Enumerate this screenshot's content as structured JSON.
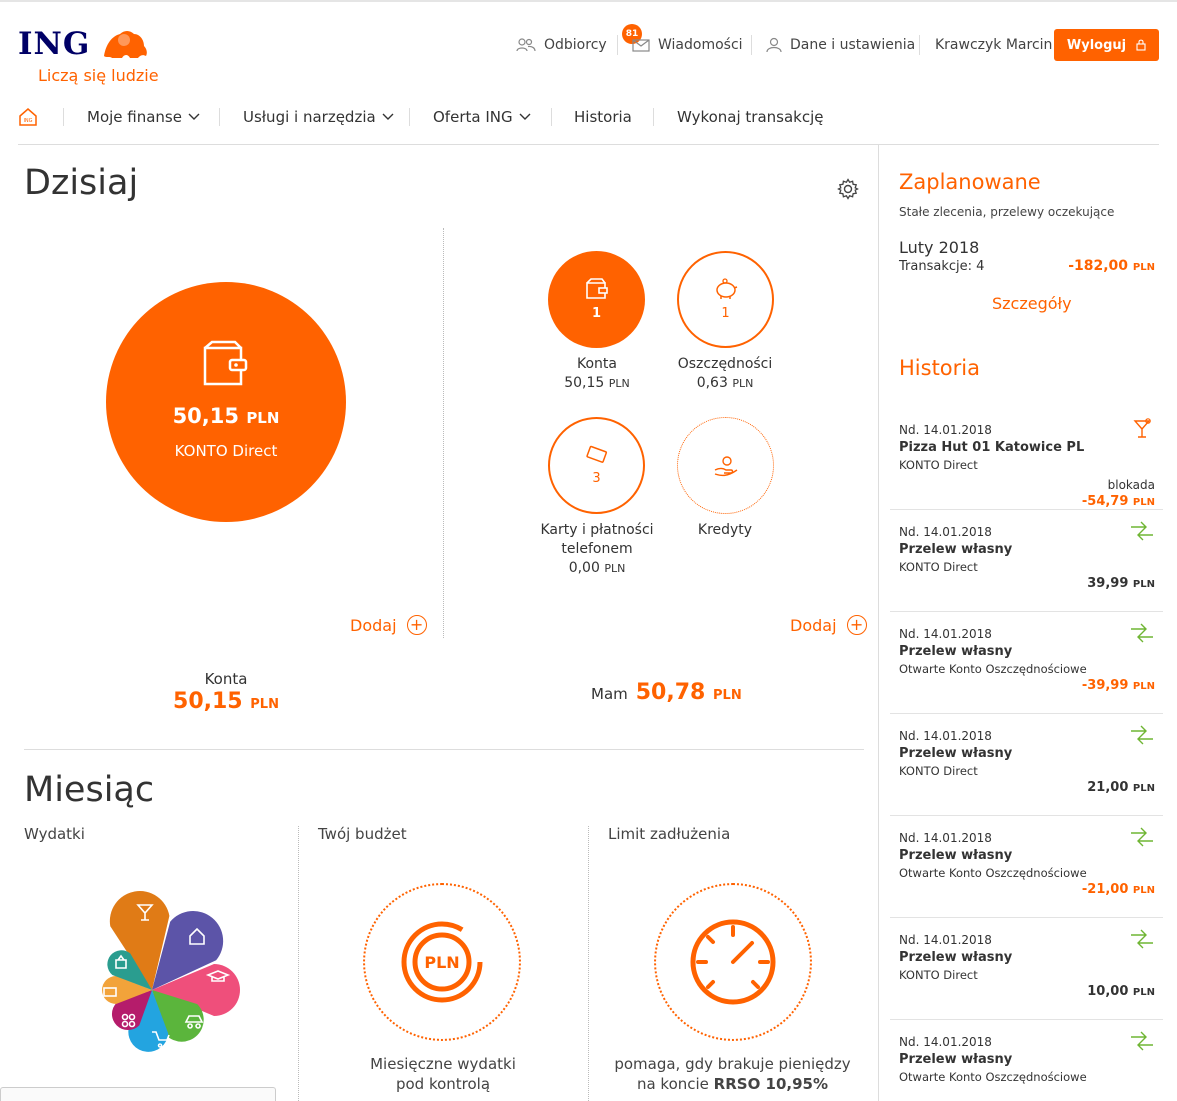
{
  "header": {
    "logo_text": "ING",
    "tagline": "Liczą się ludzie",
    "nav": {
      "recipients": "Odbiorcy",
      "messages": "Wiadomości",
      "messages_badge": "81",
      "settings": "Dane i ustawienia",
      "user_name": "Krawczyk Marcin",
      "logout": "Wyloguj"
    }
  },
  "main_nav": {
    "my_finances": "Moje finanse",
    "services": "Usługi i narzędzia",
    "offer": "Oferta ING",
    "history": "Historia",
    "transaction": "Wykonaj transakcję"
  },
  "today": {
    "title": "Dzisiaj",
    "main_account": {
      "amount": "50,15",
      "currency": "PLN",
      "name": "KONTO Direct"
    },
    "products": [
      {
        "count": "1",
        "label": "Konta",
        "amount": "50,15",
        "currency": "PLN"
      },
      {
        "count": "1",
        "label": "Oszczędności",
        "amount": "0,63",
        "currency": "PLN"
      },
      {
        "count": "3",
        "label_line1": "Karty i płatności",
        "label_line2": "telefonem",
        "amount": "0,00",
        "currency": "PLN"
      },
      {
        "label": "Kredyty"
      }
    ],
    "add_label": "Dodaj",
    "summary_accounts_label": "Konta",
    "summary_accounts_amount": "50,15",
    "summary_have_label": "Mam",
    "summary_have_amount": "50,78",
    "currency": "PLN"
  },
  "month": {
    "title": "Miesiąc",
    "expenses_label": "Wydatki",
    "budget_label": "Twój budżet",
    "budget_desc_1": "Miesięczne wydatki",
    "budget_desc_2": "pod kontrolą",
    "budget_icon_text": "PLN",
    "limit_label": "Limit zadłużenia",
    "limit_desc_1": "pomaga, gdy brakuje pieniędzy",
    "limit_desc_2": "na koncie ",
    "limit_desc_rrso": "RRSO 10,95%",
    "petal_colors": [
      "#e07b16",
      "#5c54a8",
      "#ef4f7b",
      "#5bb53c",
      "#23a4e0",
      "#b51c6b",
      "#f2a33a",
      "#2a9d8f"
    ]
  },
  "planned": {
    "title": "Zaplanowane",
    "subtitle": "Stałe zlecenia, przelewy oczekujące",
    "month": "Luty 2018",
    "transactions_label": "Transakcje: 4",
    "amount": "-182,00",
    "currency": "PLN",
    "details": "Szczegóły"
  },
  "history": {
    "title": "Historia",
    "items": [
      {
        "date": "Nd. 14.01.2018",
        "name": "Pizza Hut 01 Katowice PL",
        "account": "KONTO Direct",
        "status": "blokada",
        "amount": "-54,79",
        "currency": "PLN",
        "icon": "cocktail-icon"
      },
      {
        "date": "Nd. 14.01.2018",
        "name": "Przelew własny",
        "account": "KONTO Direct",
        "amount": "39,99",
        "currency": "PLN",
        "icon": "transfer-arrows-icon"
      },
      {
        "date": "Nd. 14.01.2018",
        "name": "Przelew własny",
        "account": "Otwarte Konto Oszczędnościowe",
        "amount": "-39,99",
        "currency": "PLN",
        "icon": "transfer-arrows-icon"
      },
      {
        "date": "Nd. 14.01.2018",
        "name": "Przelew własny",
        "account": "KONTO Direct",
        "amount": "21,00",
        "currency": "PLN",
        "icon": "transfer-arrows-icon"
      },
      {
        "date": "Nd. 14.01.2018",
        "name": "Przelew własny",
        "account": "Otwarte Konto Oszczędnościowe",
        "amount": "-21,00",
        "currency": "PLN",
        "icon": "transfer-arrows-icon"
      },
      {
        "date": "Nd. 14.01.2018",
        "name": "Przelew własny",
        "account": "KONTO Direct",
        "amount": "10,00",
        "currency": "PLN",
        "icon": "transfer-arrows-icon"
      },
      {
        "date": "Nd. 14.01.2018",
        "name": "Przelew własny",
        "account": "Otwarte Konto Oszczędnościowe",
        "icon": "transfer-arrows-icon"
      }
    ]
  },
  "colors": {
    "brand_orange": "#ff6200",
    "brand_navy": "#000066",
    "transfer_green": "#6fb533"
  }
}
